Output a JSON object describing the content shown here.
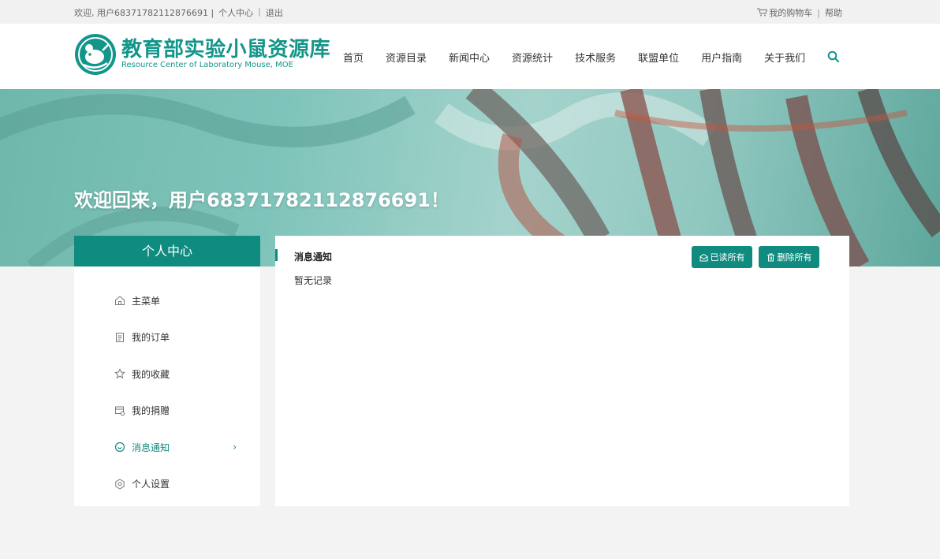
{
  "topbar": {
    "greeting": "欢迎, 用户68371782112876691 |",
    "personal_center": "个人中心",
    "separator": "|",
    "logout": "退出",
    "cart": "我的购物车",
    "help": "帮助"
  },
  "logo": {
    "title_cn": "教育部实验小鼠资源库",
    "title_en": "Resource Center of Laboratory Mouse, MOE"
  },
  "nav": [
    "首页",
    "资源目录",
    "新闻中心",
    "资源统计",
    "技术服务",
    "联盟单位",
    "用户指南",
    "关于我们"
  ],
  "banner": {
    "welcome": "欢迎回来，用户68371782112876691！"
  },
  "sidebar": {
    "title": "个人中心",
    "items": [
      {
        "label": "主菜单",
        "icon": "home-icon"
      },
      {
        "label": "我的订单",
        "icon": "order-icon"
      },
      {
        "label": "我的收藏",
        "icon": "star-icon"
      },
      {
        "label": "我的捐赠",
        "icon": "donation-icon"
      },
      {
        "label": "消息通知",
        "icon": "message-icon",
        "active": true
      },
      {
        "label": "个人设置",
        "icon": "settings-icon"
      }
    ],
    "active_chevron": "›"
  },
  "panel": {
    "title": "消息通知",
    "empty_text": "暂无记录",
    "mark_all_read": "已读所有",
    "delete_all": "删除所有"
  },
  "colors": {
    "brand": "#0f8b80",
    "logo": "#14958a"
  }
}
